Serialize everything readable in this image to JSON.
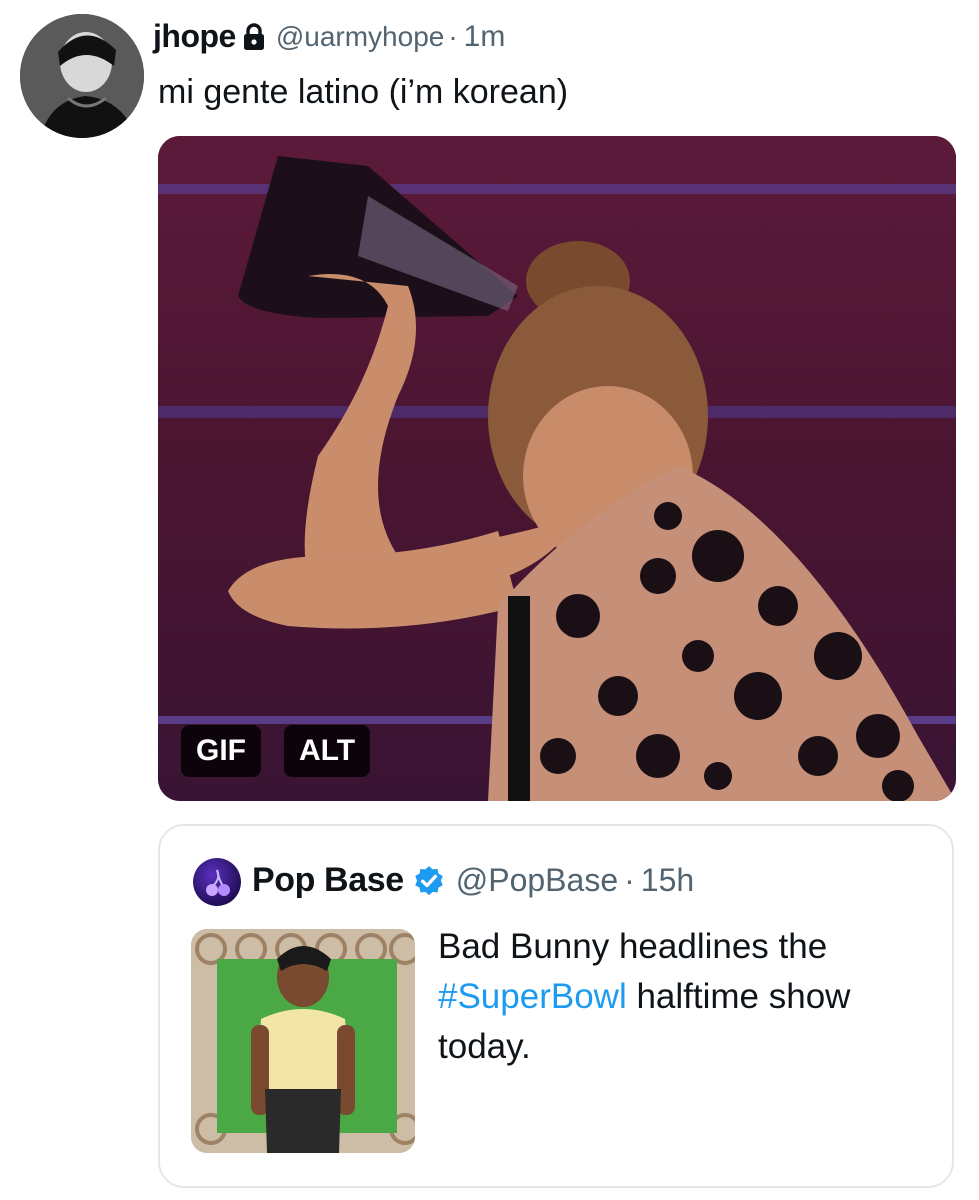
{
  "tweet": {
    "display_name": "jhope",
    "handle": "@uarmyhope",
    "separator": "·",
    "time": "1m",
    "text": "mi gente latino (i’m korean)",
    "media": {
      "gif_label": "GIF",
      "alt_label": "ALT"
    }
  },
  "quoted": {
    "display_name": "Pop Base",
    "handle": "@PopBase",
    "separator": "·",
    "time": "15h",
    "text_before": "Bad Bunny headlines the",
    "hashtag": "#SuperBowl",
    "text_after": "halftime show today."
  },
  "colors": {
    "link": "#1d9bf0",
    "muted": "#536471",
    "verified": "#1d9bf0"
  }
}
